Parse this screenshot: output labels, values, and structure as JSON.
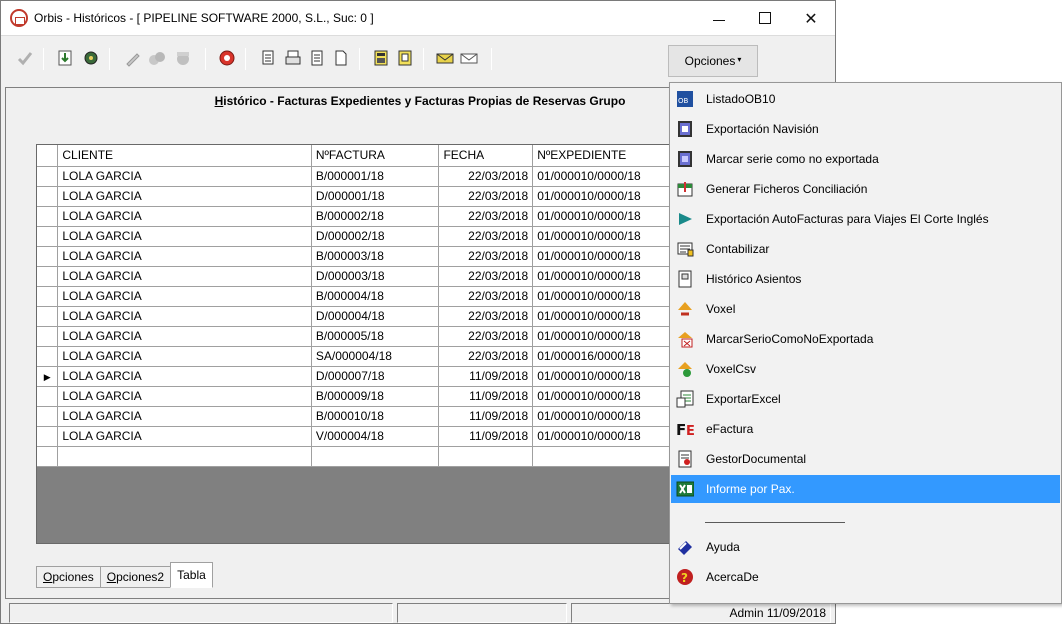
{
  "window": {
    "title": "Orbis - Históricos - [ PIPELINE SOFTWARE 2000, S.L.,  Suc: 0 ]",
    "min_glyph": "—",
    "close_glyph": "✕"
  },
  "toolbar": {
    "opciones_label": "Opciones",
    "opciones_caret": "▾"
  },
  "panel": {
    "title_first_letter": "H",
    "title_rest": "istórico - Facturas Expedientes y Facturas Propias de Reservas Grupo"
  },
  "grid": {
    "columns": [
      "CLIENTE",
      "NºFACTURA",
      "FECHA",
      "NºEXPEDIENTE"
    ],
    "current_row_marker": "▶",
    "rows": [
      [
        "LOLA GARCIA",
        "B/000001/18",
        "22/03/2018",
        "01/000010/0000/18"
      ],
      [
        "LOLA GARCIA",
        "D/000001/18",
        "22/03/2018",
        "01/000010/0000/18"
      ],
      [
        "LOLA GARCIA",
        "B/000002/18",
        "22/03/2018",
        "01/000010/0000/18"
      ],
      [
        "LOLA GARCIA",
        "D/000002/18",
        "22/03/2018",
        "01/000010/0000/18"
      ],
      [
        "LOLA GARCIA",
        "B/000003/18",
        "22/03/2018",
        "01/000010/0000/18"
      ],
      [
        "LOLA GARCIA",
        "D/000003/18",
        "22/03/2018",
        "01/000010/0000/18"
      ],
      [
        "LOLA GARCIA",
        "B/000004/18",
        "22/03/2018",
        "01/000010/0000/18"
      ],
      [
        "LOLA GARCIA",
        "D/000004/18",
        "22/03/2018",
        "01/000010/0000/18"
      ],
      [
        "LOLA GARCIA",
        "B/000005/18",
        "22/03/2018",
        "01/000010/0000/18"
      ],
      [
        "LOLA GARCIA",
        "SA/000004/18",
        "22/03/2018",
        "01/000016/0000/18"
      ],
      [
        "LOLA GARCIA",
        "D/000007/18",
        "11/09/2018",
        "01/000010/0000/18"
      ],
      [
        "LOLA GARCIA",
        "B/000009/18",
        "11/09/2018",
        "01/000010/0000/18"
      ],
      [
        "LOLA GARCIA",
        "B/000010/18",
        "11/09/2018",
        "01/000010/0000/18"
      ],
      [
        "LOLA GARCIA",
        "V/000004/18",
        "11/09/2018",
        "01/000010/0000/18"
      ]
    ],
    "current_row_index": 10
  },
  "tabs": [
    {
      "first": "O",
      "rest": "pciones"
    },
    {
      "first": "O",
      "rest": "pciones2"
    },
    {
      "first": "",
      "rest": "Tabla"
    }
  ],
  "statusbar": {
    "user_date": "Admin 11/09/2018"
  },
  "menu": {
    "items": [
      {
        "label": "ListadoOB10",
        "icon": "ob10-icon"
      },
      {
        "label": "Exportación Navisión",
        "icon": "navision-icon"
      },
      {
        "label": "Marcar serie como no exportada",
        "icon": "mark-serie-icon"
      },
      {
        "label": "Generar Ficheros Conciliación",
        "icon": "conciliation-icon"
      },
      {
        "label": "Exportación AutoFacturas para Viajes El Corte Inglés",
        "icon": "flag-icon"
      },
      {
        "label": "Contabilizar",
        "icon": "accounting-icon"
      },
      {
        "label": "Histórico Asientos",
        "icon": "history-icon"
      },
      {
        "label": "Voxel",
        "icon": "voxel-icon"
      },
      {
        "label": "MarcarSerioComoNoExportada",
        "icon": "mark-no-export-icon"
      },
      {
        "label": "VoxelCsv",
        "icon": "voxel-csv-icon"
      },
      {
        "label": "ExportarExcel",
        "icon": "export-excel-icon"
      },
      {
        "label": "eFactura",
        "icon": "efactura-icon"
      },
      {
        "label": "GestorDocumental",
        "icon": "document-manager-icon"
      },
      {
        "label": "Informe por Pax.",
        "icon": "excel-report-icon"
      },
      {
        "label": "Ayuda",
        "icon": "help-icon"
      },
      {
        "label": "AcercaDe",
        "icon": "about-icon"
      }
    ],
    "selected_index": 13,
    "efactura_glyph": "FE"
  },
  "colors": {
    "menu_highlight": "#3399ff",
    "grid_background": "#808080",
    "window_bg": "#f0f0f0"
  }
}
